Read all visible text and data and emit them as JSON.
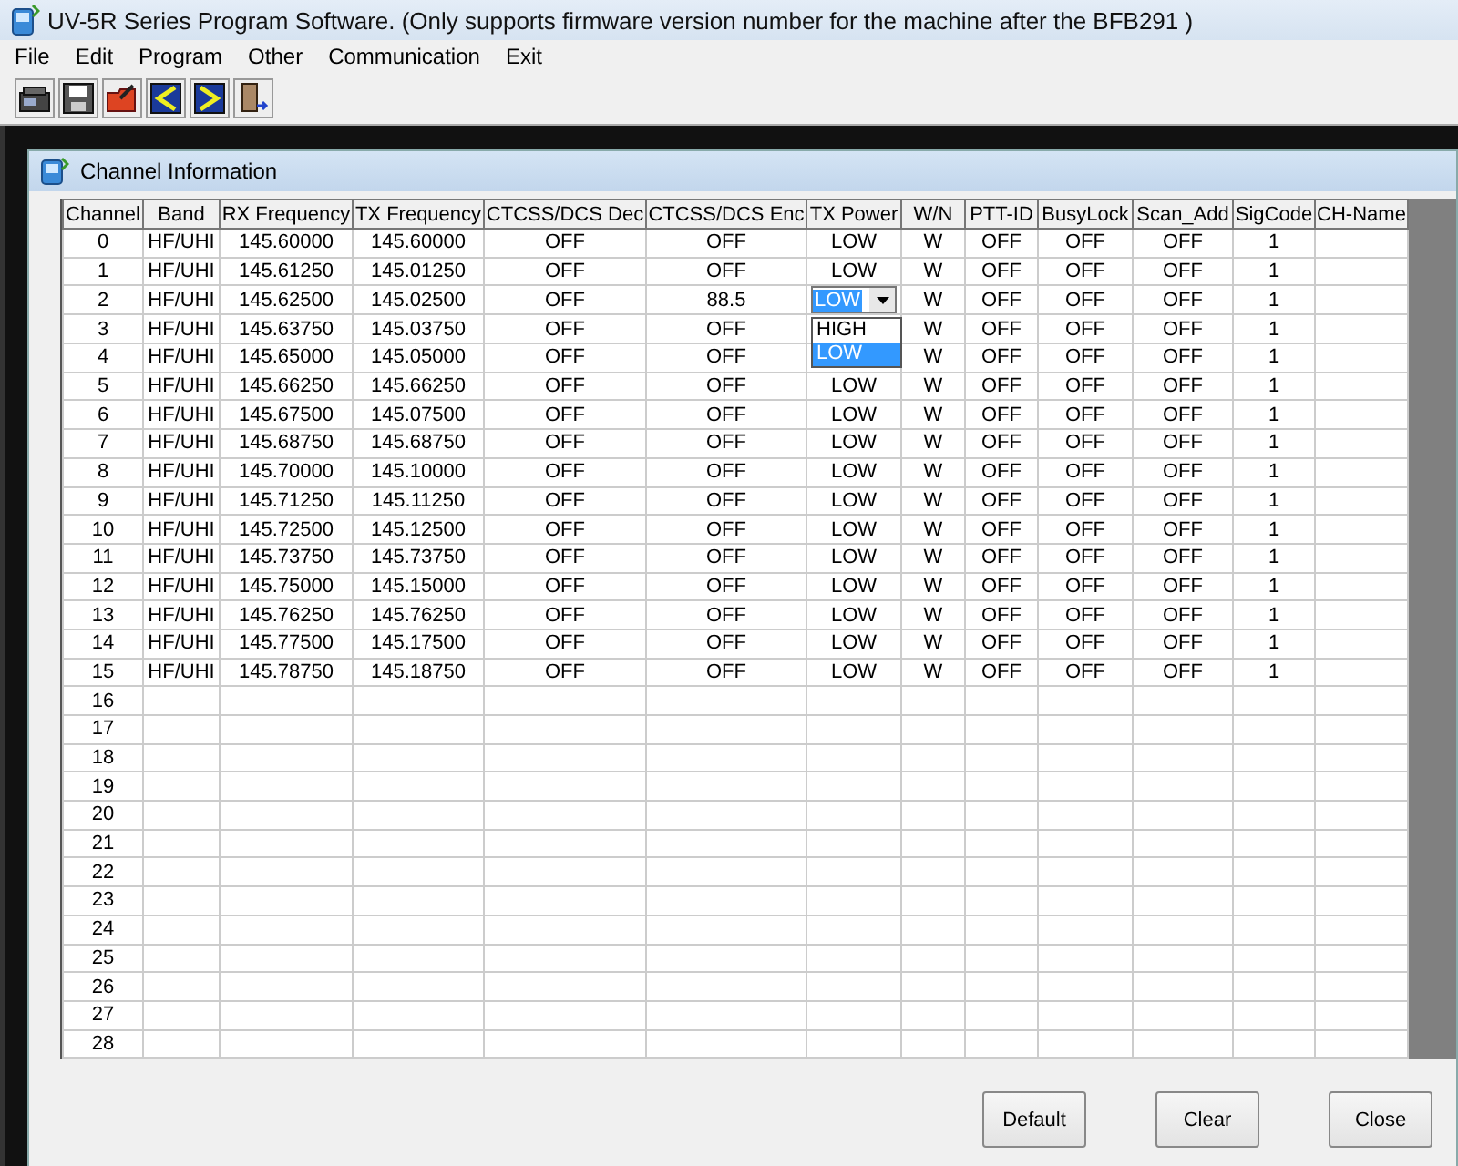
{
  "window": {
    "title": "UV-5R Series Program Software. (Only supports firmware version number for the machine after the BFB291 )"
  },
  "menu": [
    "File",
    "Edit",
    "Program",
    "Other",
    "Communication",
    "Exit"
  ],
  "toolbar": [
    {
      "kind": "read"
    },
    {
      "kind": "save"
    },
    {
      "kind": "open"
    },
    {
      "kind": "download"
    },
    {
      "kind": "upload"
    },
    {
      "kind": "exit"
    }
  ],
  "dialog": {
    "title": "Channel Information",
    "table": {
      "columns": [
        "Channel",
        "Band",
        "RX Frequency",
        "TX Frequency",
        "CTCSS/DCS Dec",
        "CTCSS/DCS Enc",
        "TX Power",
        "W/N",
        "PTT-ID",
        "BusyLock",
        "Scan_Add",
        "SigCode",
        "CH-Name"
      ],
      "rows": [
        {
          "cells": [
            "0",
            "HF/UHI",
            "145.60000",
            "145.60000",
            "OFF",
            "OFF",
            "LOW",
            "W",
            "OFF",
            "OFF",
            "OFF",
            "1"
          ]
        },
        {
          "cells": [
            "1",
            "HF/UHI",
            "145.61250",
            "145.01250",
            "OFF",
            "OFF",
            "LOW",
            "W",
            "OFF",
            "OFF",
            "OFF",
            "1"
          ]
        },
        {
          "cells": [
            "2",
            "HF/UHI",
            "145.62500",
            "145.02500",
            "OFF",
            "88.5",
            {
              "kind": "dropdown",
              "value": "LOW",
              "options": [
                {
                  "label": "HIGH",
                  "selected": false
                },
                {
                  "label": "LOW",
                  "selected": true
                }
              ]
            },
            "W",
            "OFF",
            "OFF",
            "OFF",
            "1"
          ]
        },
        {
          "cells": [
            "3",
            "HF/UHI",
            "145.63750",
            "145.03750",
            "OFF",
            "OFF",
            null,
            "W",
            "OFF",
            "OFF",
            "OFF",
            "1"
          ]
        },
        {
          "cells": [
            "4",
            "HF/UHI",
            "145.65000",
            "145.05000",
            "OFF",
            "OFF",
            null,
            "W",
            "OFF",
            "OFF",
            "OFF",
            "1"
          ]
        },
        {
          "cells": [
            "5",
            "HF/UHI",
            "145.66250",
            "145.66250",
            "OFF",
            "OFF",
            "LOW",
            "W",
            "OFF",
            "OFF",
            "OFF",
            "1"
          ]
        },
        {
          "cells": [
            "6",
            "HF/UHI",
            "145.67500",
            "145.07500",
            "OFF",
            "OFF",
            "LOW",
            "W",
            "OFF",
            "OFF",
            "OFF",
            "1"
          ]
        },
        {
          "cells": [
            "7",
            "HF/UHI",
            "145.68750",
            "145.68750",
            "OFF",
            "OFF",
            "LOW",
            "W",
            "OFF",
            "OFF",
            "OFF",
            "1"
          ]
        },
        {
          "cells": [
            "8",
            "HF/UHI",
            "145.70000",
            "145.10000",
            "OFF",
            "OFF",
            "LOW",
            "W",
            "OFF",
            "OFF",
            "OFF",
            "1"
          ]
        },
        {
          "cells": [
            "9",
            "HF/UHI",
            "145.71250",
            "145.11250",
            "OFF",
            "OFF",
            "LOW",
            "W",
            "OFF",
            "OFF",
            "OFF",
            "1"
          ]
        },
        {
          "cells": [
            "10",
            "HF/UHI",
            "145.72500",
            "145.12500",
            "OFF",
            "OFF",
            "LOW",
            "W",
            "OFF",
            "OFF",
            "OFF",
            "1"
          ]
        },
        {
          "cells": [
            "11",
            "HF/UHI",
            "145.73750",
            "145.73750",
            "OFF",
            "OFF",
            "LOW",
            "W",
            "OFF",
            "OFF",
            "OFF",
            "1"
          ]
        },
        {
          "cells": [
            "12",
            "HF/UHI",
            "145.75000",
            "145.15000",
            "OFF",
            "OFF",
            "LOW",
            "W",
            "OFF",
            "OFF",
            "OFF",
            "1"
          ]
        },
        {
          "cells": [
            "13",
            "HF/UHI",
            "145.76250",
            "145.76250",
            "OFF",
            "OFF",
            "LOW",
            "W",
            "OFF",
            "OFF",
            "OFF",
            "1"
          ]
        },
        {
          "cells": [
            "14",
            "HF/UHI",
            "145.77500",
            "145.17500",
            "OFF",
            "OFF",
            "LOW",
            "W",
            "OFF",
            "OFF",
            "OFF",
            "1"
          ]
        },
        {
          "cells": [
            "15",
            "HF/UHI",
            "145.78750",
            "145.18750",
            "OFF",
            "OFF",
            "LOW",
            "W",
            "OFF",
            "OFF",
            "OFF",
            "1"
          ]
        },
        {
          "cells": [
            "16"
          ]
        },
        {
          "cells": [
            "17"
          ]
        },
        {
          "cells": [
            "18"
          ]
        },
        {
          "cells": [
            "19"
          ]
        },
        {
          "cells": [
            "20"
          ]
        },
        {
          "cells": [
            "21"
          ]
        },
        {
          "cells": [
            "22"
          ]
        },
        {
          "cells": [
            "23"
          ]
        },
        {
          "cells": [
            "24"
          ]
        },
        {
          "cells": [
            "25"
          ]
        },
        {
          "cells": [
            "26"
          ]
        },
        {
          "cells": [
            "27"
          ]
        },
        {
          "cells": [
            "28"
          ]
        }
      ]
    },
    "buttons": [
      "Default",
      "Clear",
      "Close"
    ]
  }
}
